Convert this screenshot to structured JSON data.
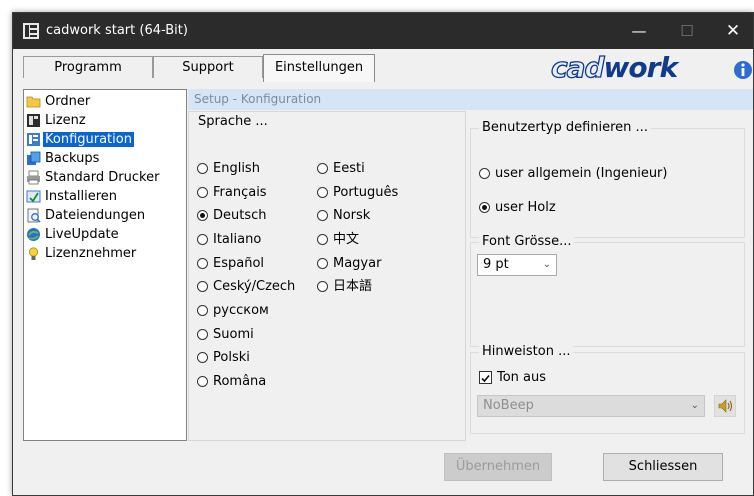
{
  "window": {
    "title": "cadwork start (64-Bit)",
    "minimize_icon": "minimize-icon",
    "maximize_icon": "maximize-icon",
    "close_icon": "close-icon"
  },
  "tabs": [
    {
      "label": "Programm"
    },
    {
      "label": "Support"
    },
    {
      "label": "Einstellungen",
      "active": true
    }
  ],
  "logo": {
    "part1": "cad",
    "part2": "work"
  },
  "sidebar": {
    "items": [
      {
        "label": "Ordner",
        "icon": "folder-icon"
      },
      {
        "label": "Lizenz",
        "icon": "license-icon"
      },
      {
        "label": "Konfiguration",
        "icon": "configuration-icon",
        "selected": true
      },
      {
        "label": "Backups",
        "icon": "backups-icon"
      },
      {
        "label": "Standard Drucker",
        "icon": "printer-icon"
      },
      {
        "label": "Installieren",
        "icon": "install-icon"
      },
      {
        "label": "Dateiendungen",
        "icon": "file-extensions-icon"
      },
      {
        "label": "LiveUpdate",
        "icon": "liveupdate-icon"
      },
      {
        "label": "Lizenznehmer",
        "icon": "licensee-icon"
      }
    ]
  },
  "setup_header": "Setup - Konfiguration",
  "language": {
    "title": "Sprache ...",
    "col1": [
      "English",
      "Français",
      "Deutsch",
      "Italiano",
      "Español",
      "Ceský/Czech",
      "русском",
      "Suomi",
      "Polski",
      "Româna"
    ],
    "col2": [
      "Eesti",
      "Português",
      "Norsk",
      "中文",
      "Magyar",
      "日本語"
    ],
    "selected": "Deutsch"
  },
  "user_type": {
    "title": "Benutzertyp definieren ...",
    "options": [
      "user allgemein (Ingenieur)",
      "user Holz"
    ],
    "selected": "user Holz"
  },
  "font_size": {
    "title": "Font Grösse...",
    "value": "9 pt"
  },
  "sound": {
    "title": "Hinweiston ...",
    "checkbox_label": "Ton aus",
    "checked": true,
    "select_value": "NoBeep",
    "speaker_icon": "speaker-icon"
  },
  "buttons": {
    "apply": "Übernehmen",
    "close": "Schliessen"
  },
  "colors": {
    "titlebar": "#2b2b2b",
    "selection": "#0a64d2",
    "header_band": "#d6e5f5",
    "logo": "#123a8c"
  }
}
